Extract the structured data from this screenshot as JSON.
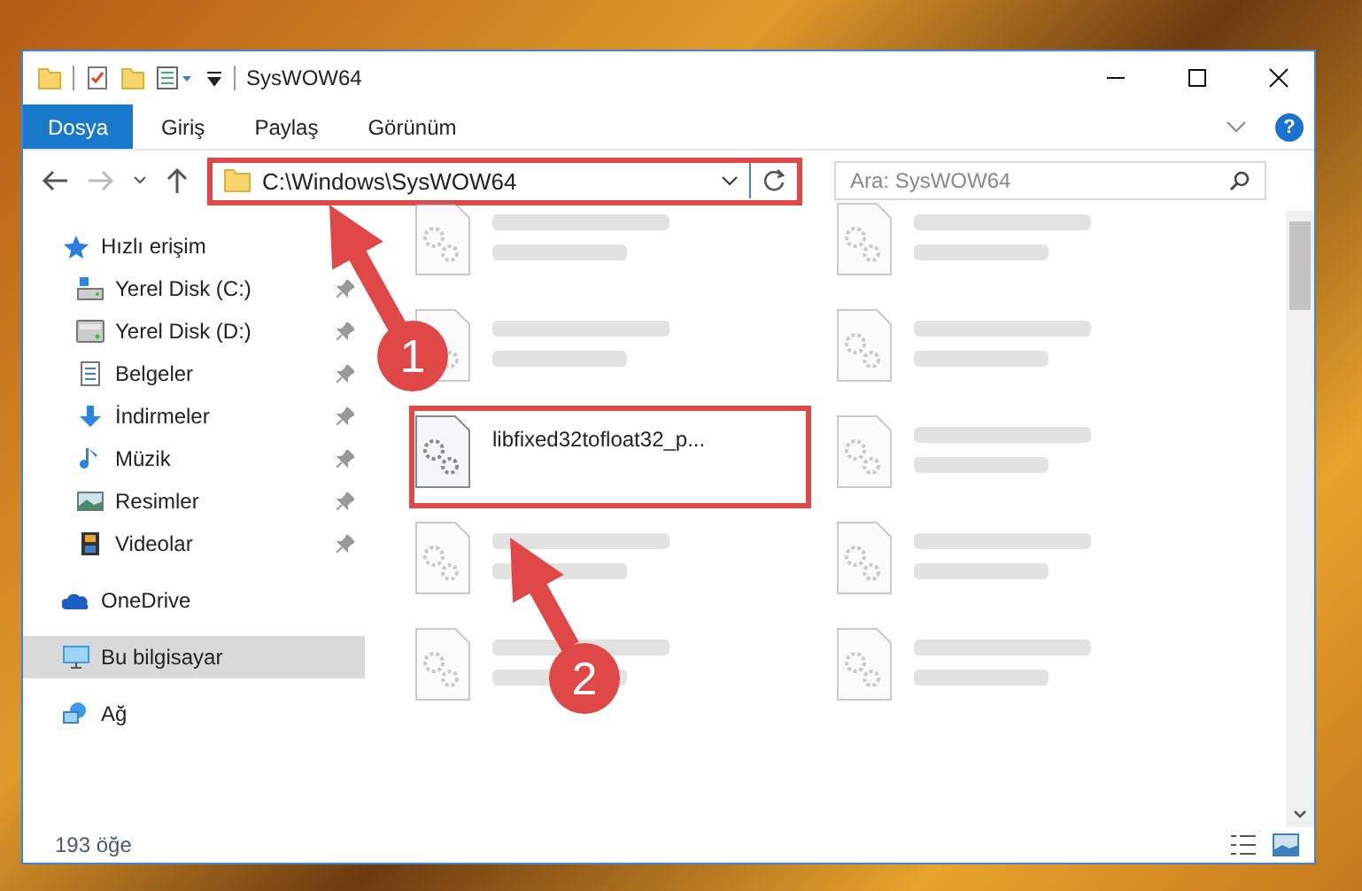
{
  "window": {
    "title": "SysWOW64"
  },
  "ribbon_tabs": [
    {
      "label": "Dosya",
      "selected": true
    },
    {
      "label": "Giriş",
      "selected": false
    },
    {
      "label": "Paylaş",
      "selected": false
    },
    {
      "label": "Görünüm",
      "selected": false
    }
  ],
  "help_button": {
    "label": "?"
  },
  "address_bar": {
    "path": "C:\\Windows\\SysWOW64",
    "highlighted": true
  },
  "search": {
    "placeholder": "Ara: SysWOW64"
  },
  "sidebar": {
    "items": [
      {
        "label": "Hızlı erişim",
        "selected": false,
        "children": [
          {
            "label": "Yerel Disk (C:)",
            "pinned": true,
            "selected": false
          },
          {
            "label": "Yerel Disk (D:)",
            "pinned": true,
            "selected": false
          },
          {
            "label": "Belgeler",
            "pinned": true,
            "selected": false
          },
          {
            "label": "İndirmeler",
            "pinned": true,
            "selected": false
          },
          {
            "label": "Müzik",
            "pinned": true,
            "selected": false
          },
          {
            "label": "Resimler",
            "pinned": true,
            "selected": false
          },
          {
            "label": "Videolar",
            "pinned": true,
            "selected": false
          }
        ]
      },
      {
        "label": "OneDrive",
        "selected": false
      },
      {
        "label": "Bu bilgisayar",
        "selected": true
      },
      {
        "label": "Ağ",
        "selected": false
      }
    ]
  },
  "files": [
    {
      "blurred": true,
      "highlighted": false
    },
    {
      "blurred": true,
      "highlighted": false
    },
    {
      "blurred": true,
      "highlighted": false
    },
    {
      "blurred": true,
      "highlighted": false
    },
    {
      "name": "libfixed32tofloat32_p...",
      "blurred": false,
      "highlighted": true
    },
    {
      "blurred": true,
      "highlighted": false
    },
    {
      "blurred": true,
      "highlighted": false
    },
    {
      "blurred": true,
      "highlighted": false
    },
    {
      "blurred": true,
      "highlighted": false
    },
    {
      "blurred": true,
      "highlighted": false
    }
  ],
  "status_bar": {
    "count": "193 öğe"
  },
  "annotations": [
    {
      "number": "1"
    },
    {
      "number": "2"
    }
  ]
}
